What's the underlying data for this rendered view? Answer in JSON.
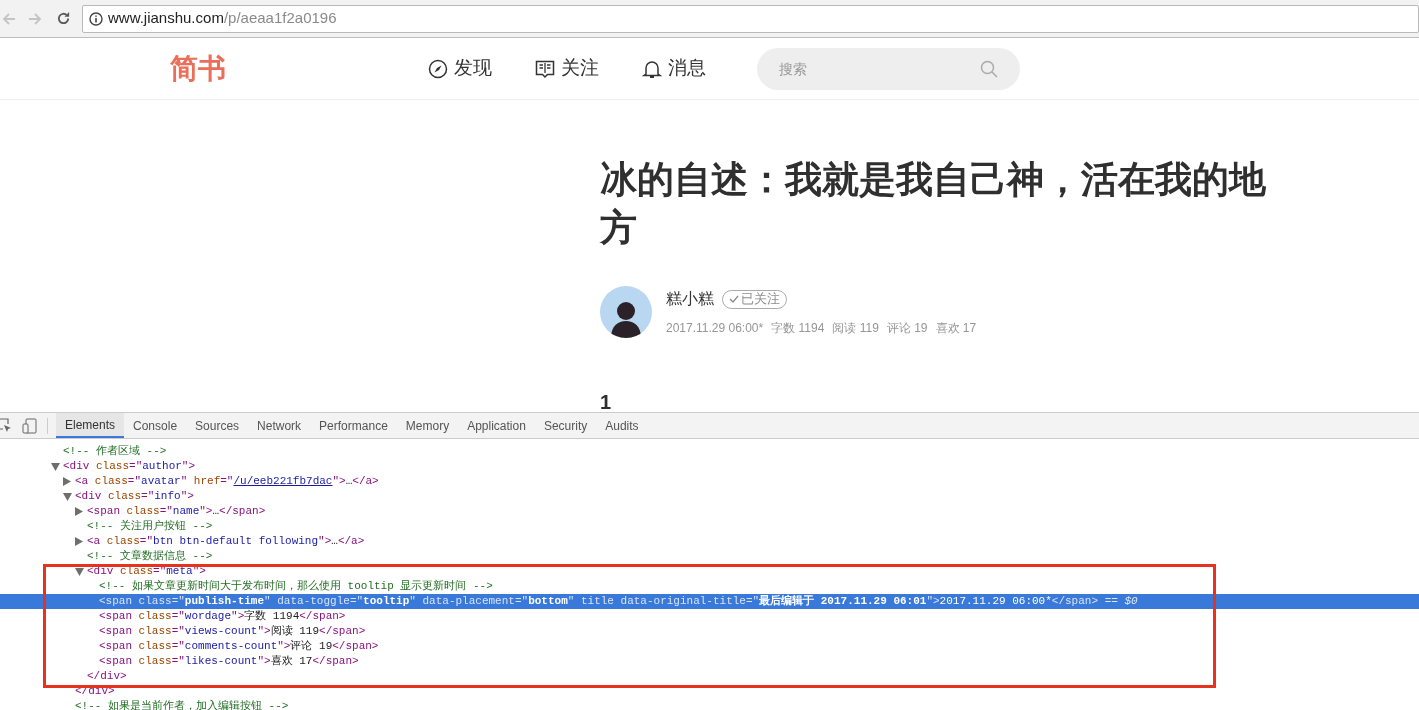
{
  "browser": {
    "url_host": "www.jianshu.com",
    "url_path": "/p/aeaa1f2a0196"
  },
  "header": {
    "logo": "简书",
    "nav": [
      {
        "kind": "discover",
        "label": "发现"
      },
      {
        "kind": "follow",
        "label": "关注"
      },
      {
        "kind": "messages",
        "label": "消息"
      }
    ],
    "search": {
      "placeholder": "搜索"
    }
  },
  "article": {
    "title": "冰的自述：我就是我自己神，活在我的地方",
    "author": {
      "name": "糕小糕",
      "following": true,
      "follow_label": "已关注",
      "meta": [
        "2017.11.29 06:00*",
        "字数 1194",
        "阅读 119",
        "评论 19",
        "喜欢 17"
      ]
    },
    "first_heading": "1"
  },
  "devtools": {
    "tabs": [
      {
        "label": "Elements",
        "selected": true
      },
      {
        "label": "Console",
        "selected": false
      },
      {
        "label": "Sources",
        "selected": false
      },
      {
        "label": "Network",
        "selected": false
      },
      {
        "label": "Performance",
        "selected": false
      },
      {
        "label": "Memory",
        "selected": false
      },
      {
        "label": "Application",
        "selected": false
      },
      {
        "label": "Security",
        "selected": false
      },
      {
        "label": "Audits",
        "selected": false
      }
    ],
    "tree": [
      {
        "selected": false,
        "segments": [
          {
            "kind": "comment",
            "text": "<!-- 作者区域 -->"
          }
        ]
      },
      {
        "selected": false,
        "expanded": true,
        "segments": [
          {
            "kind": "tag",
            "text": "<div "
          },
          {
            "kind": "attr",
            "text": "class"
          },
          {
            "kind": "tag",
            "text": "=\""
          },
          {
            "kind": "value",
            "text": "author"
          },
          {
            "kind": "tag",
            "text": "\">"
          }
        ],
        "children": [
          {
            "selected": false,
            "expanded": false,
            "segments": [
              {
                "kind": "tag",
                "text": "<a "
              },
              {
                "kind": "attr",
                "text": "class"
              },
              {
                "kind": "tag",
                "text": "=\""
              },
              {
                "kind": "value",
                "text": "avatar"
              },
              {
                "kind": "tag",
                "text": "\" "
              },
              {
                "kind": "attr",
                "text": "href"
              },
              {
                "kind": "tag",
                "text": "=\""
              },
              {
                "kind": "link",
                "text": "/u/eeb221fb7dac"
              },
              {
                "kind": "tag",
                "text": "\">"
              },
              {
                "kind": "text",
                "text": "…"
              },
              {
                "kind": "tag",
                "text": "</a>"
              }
            ]
          },
          {
            "selected": false,
            "expanded": true,
            "segments": [
              {
                "kind": "tag",
                "text": "<div "
              },
              {
                "kind": "attr",
                "text": "class"
              },
              {
                "kind": "tag",
                "text": "=\""
              },
              {
                "kind": "value",
                "text": "info"
              },
              {
                "kind": "tag",
                "text": "\">"
              }
            ],
            "children": [
              {
                "selected": false,
                "expanded": false,
                "segments": [
                  {
                    "kind": "tag",
                    "text": "<span "
                  },
                  {
                    "kind": "attr",
                    "text": "class"
                  },
                  {
                    "kind": "tag",
                    "text": "=\""
                  },
                  {
                    "kind": "value",
                    "text": "name"
                  },
                  {
                    "kind": "tag",
                    "text": "\">"
                  },
                  {
                    "kind": "text",
                    "text": "…"
                  },
                  {
                    "kind": "tag",
                    "text": "</span>"
                  }
                ]
              },
              {
                "selected": false,
                "segments": [
                  {
                    "kind": "comment",
                    "text": "<!-- 关注用户按钮 -->"
                  }
                ]
              },
              {
                "selected": false,
                "expanded": false,
                "segments": [
                  {
                    "kind": "tag",
                    "text": "<a "
                  },
                  {
                    "kind": "attr",
                    "text": "class"
                  },
                  {
                    "kind": "tag",
                    "text": "=\""
                  },
                  {
                    "kind": "value",
                    "text": "btn btn-default following"
                  },
                  {
                    "kind": "tag",
                    "text": "\">"
                  },
                  {
                    "kind": "text",
                    "text": "…"
                  },
                  {
                    "kind": "tag",
                    "text": "</a>"
                  }
                ]
              },
              {
                "selected": false,
                "segments": [
                  {
                    "kind": "comment",
                    "text": "<!-- 文章数据信息 -->"
                  }
                ]
              },
              {
                "selected": false,
                "expanded": true,
                "segments": [
                  {
                    "kind": "tag",
                    "text": "<div "
                  },
                  {
                    "kind": "attr",
                    "text": "class"
                  },
                  {
                    "kind": "tag",
                    "text": "=\""
                  },
                  {
                    "kind": "value",
                    "text": "meta"
                  },
                  {
                    "kind": "tag",
                    "text": "\">"
                  }
                ],
                "children": [
                  {
                    "selected": false,
                    "segments": [
                      {
                        "kind": "comment",
                        "text": "<!-- 如果文章更新时间大于发布时间，那么使用 tooltip 显示更新时间 -->"
                      }
                    ]
                  },
                  {
                    "selected": true,
                    "segments": [
                      {
                        "kind": "tag",
                        "text": "<span "
                      },
                      {
                        "kind": "attr",
                        "text": "class"
                      },
                      {
                        "kind": "tag",
                        "text": "=\""
                      },
                      {
                        "kind": "value",
                        "text": "publish-time"
                      },
                      {
                        "kind": "tag",
                        "text": "\" "
                      },
                      {
                        "kind": "attr",
                        "text": "data-toggle"
                      },
                      {
                        "kind": "tag",
                        "text": "=\""
                      },
                      {
                        "kind": "value",
                        "text": "tooltip"
                      },
                      {
                        "kind": "tag",
                        "text": "\" "
                      },
                      {
                        "kind": "attr",
                        "text": "data-placement"
                      },
                      {
                        "kind": "tag",
                        "text": "=\""
                      },
                      {
                        "kind": "value",
                        "text": "bottom"
                      },
                      {
                        "kind": "tag",
                        "text": "\" "
                      },
                      {
                        "kind": "attr",
                        "text": "title data-original-title"
                      },
                      {
                        "kind": "tag",
                        "text": "=\""
                      },
                      {
                        "kind": "value",
                        "text": "最后编辑于 2017.11.29 06:01"
                      },
                      {
                        "kind": "tag",
                        "text": "\">"
                      },
                      {
                        "kind": "text",
                        "text": "2017.11.29 06:00*"
                      },
                      {
                        "kind": "tag",
                        "text": "</span>"
                      },
                      {
                        "kind": "eq",
                        "text": " == $0"
                      }
                    ]
                  },
                  {
                    "selected": false,
                    "segments": [
                      {
                        "kind": "tag",
                        "text": "<span "
                      },
                      {
                        "kind": "attr",
                        "text": "class"
                      },
                      {
                        "kind": "tag",
                        "text": "=\""
                      },
                      {
                        "kind": "value",
                        "text": "wordage"
                      },
                      {
                        "kind": "tag",
                        "text": "\">"
                      },
                      {
                        "kind": "text",
                        "text": "字数 1194"
                      },
                      {
                        "kind": "tag",
                        "text": "</span>"
                      }
                    ]
                  },
                  {
                    "selected": false,
                    "segments": [
                      {
                        "kind": "tag",
                        "text": "<span "
                      },
                      {
                        "kind": "attr",
                        "text": "class"
                      },
                      {
                        "kind": "tag",
                        "text": "=\""
                      },
                      {
                        "kind": "value",
                        "text": "views-count"
                      },
                      {
                        "kind": "tag",
                        "text": "\">"
                      },
                      {
                        "kind": "text",
                        "text": "阅读 119"
                      },
                      {
                        "kind": "tag",
                        "text": "</span>"
                      }
                    ]
                  },
                  {
                    "selected": false,
                    "segments": [
                      {
                        "kind": "tag",
                        "text": "<span "
                      },
                      {
                        "kind": "attr",
                        "text": "class"
                      },
                      {
                        "kind": "tag",
                        "text": "=\""
                      },
                      {
                        "kind": "value",
                        "text": "comments-count"
                      },
                      {
                        "kind": "tag",
                        "text": "\">"
                      },
                      {
                        "kind": "text",
                        "text": "评论 19"
                      },
                      {
                        "kind": "tag",
                        "text": "</span>"
                      }
                    ]
                  },
                  {
                    "selected": false,
                    "segments": [
                      {
                        "kind": "tag",
                        "text": "<span "
                      },
                      {
                        "kind": "attr",
                        "text": "class"
                      },
                      {
                        "kind": "tag",
                        "text": "=\""
                      },
                      {
                        "kind": "value",
                        "text": "likes-count"
                      },
                      {
                        "kind": "tag",
                        "text": "\">"
                      },
                      {
                        "kind": "text",
                        "text": "喜欢 17"
                      },
                      {
                        "kind": "tag",
                        "text": "</span>"
                      }
                    ]
                  }
                ]
              },
              {
                "selected": false,
                "segments": [
                  {
                    "kind": "tag",
                    "text": "</div>"
                  }
                ]
              }
            ]
          },
          {
            "selected": false,
            "segments": [
              {
                "kind": "tag",
                "text": "</div>"
              }
            ]
          },
          {
            "selected": false,
            "segments": [
              {
                "kind": "comment",
                "text": "<!-- 如果是当前作者，加入编辑按钮 -->"
              }
            ]
          }
        ]
      }
    ]
  }
}
